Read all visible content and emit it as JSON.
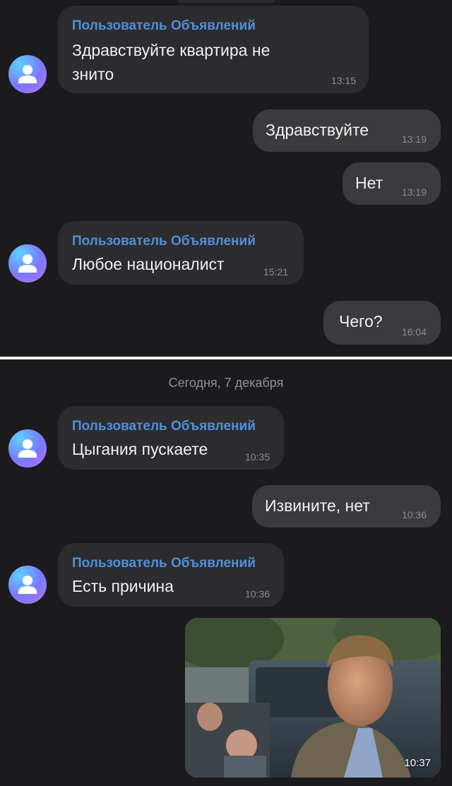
{
  "sender_name": "Пользователь Объявлений",
  "panel1": {
    "messages": [
      {
        "from": "seller",
        "text_line1": "Здравствуйте квартира не",
        "text_line2": "знито",
        "time": "13:15"
      },
      {
        "from": "me",
        "text": "Здравствуйте",
        "time": "13:19"
      },
      {
        "from": "me",
        "text": "Нет",
        "time": "13:19"
      },
      {
        "from": "seller",
        "text": "Любое националист",
        "time": "15:21"
      },
      {
        "from": "me",
        "text": "Чего?",
        "time": "16:04"
      }
    ]
  },
  "panel2": {
    "date_label": "Сегодня, 7 декабря",
    "messages": [
      {
        "from": "seller",
        "text": "Цыгания пускаете",
        "time": "10:35"
      },
      {
        "from": "me",
        "text": "Извините, нет",
        "time": "10:36"
      },
      {
        "from": "seller",
        "text": "Есть причина",
        "time": "10:36"
      },
      {
        "from": "me",
        "type": "photo",
        "time": "10:37"
      }
    ]
  },
  "icons": {
    "avatar": "user-avatar-icon"
  },
  "colors": {
    "background": "#1b1b1d",
    "incoming_bubble": "#2c2c2f",
    "outgoing_bubble": "#3b3b3e",
    "sender_name": "#4f8fd9"
  }
}
